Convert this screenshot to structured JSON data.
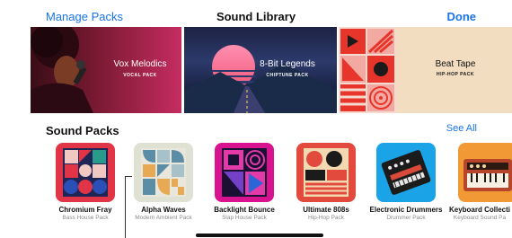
{
  "nav": {
    "left": "Manage Packs",
    "title": "Sound Library",
    "right": "Done"
  },
  "banners": [
    {
      "title": "Vox Melodics",
      "subtitle": "VOCAL PACK"
    },
    {
      "title": "8-Bit Legends",
      "subtitle": "CHIPTUNE PACK"
    },
    {
      "title": "Beat Tape",
      "subtitle": "HIP-HOP PACK"
    }
  ],
  "section": {
    "title": "Sound Packs",
    "see_all": "See All"
  },
  "packs": [
    {
      "name": "Chromium Fray",
      "sub": "Bass House Pack"
    },
    {
      "name": "Alpha Waves",
      "sub": "Modern Ambient Pack"
    },
    {
      "name": "Backlight Bounce",
      "sub": "Slap House Pack"
    },
    {
      "name": "Ultimate 808s",
      "sub": "Hip-Hop Pack"
    },
    {
      "name": "Electronic Drummers",
      "sub": "Drummer Pack"
    },
    {
      "name": "Keyboard Collecti",
      "sub": "Keyboard Sound Pa"
    }
  ]
}
